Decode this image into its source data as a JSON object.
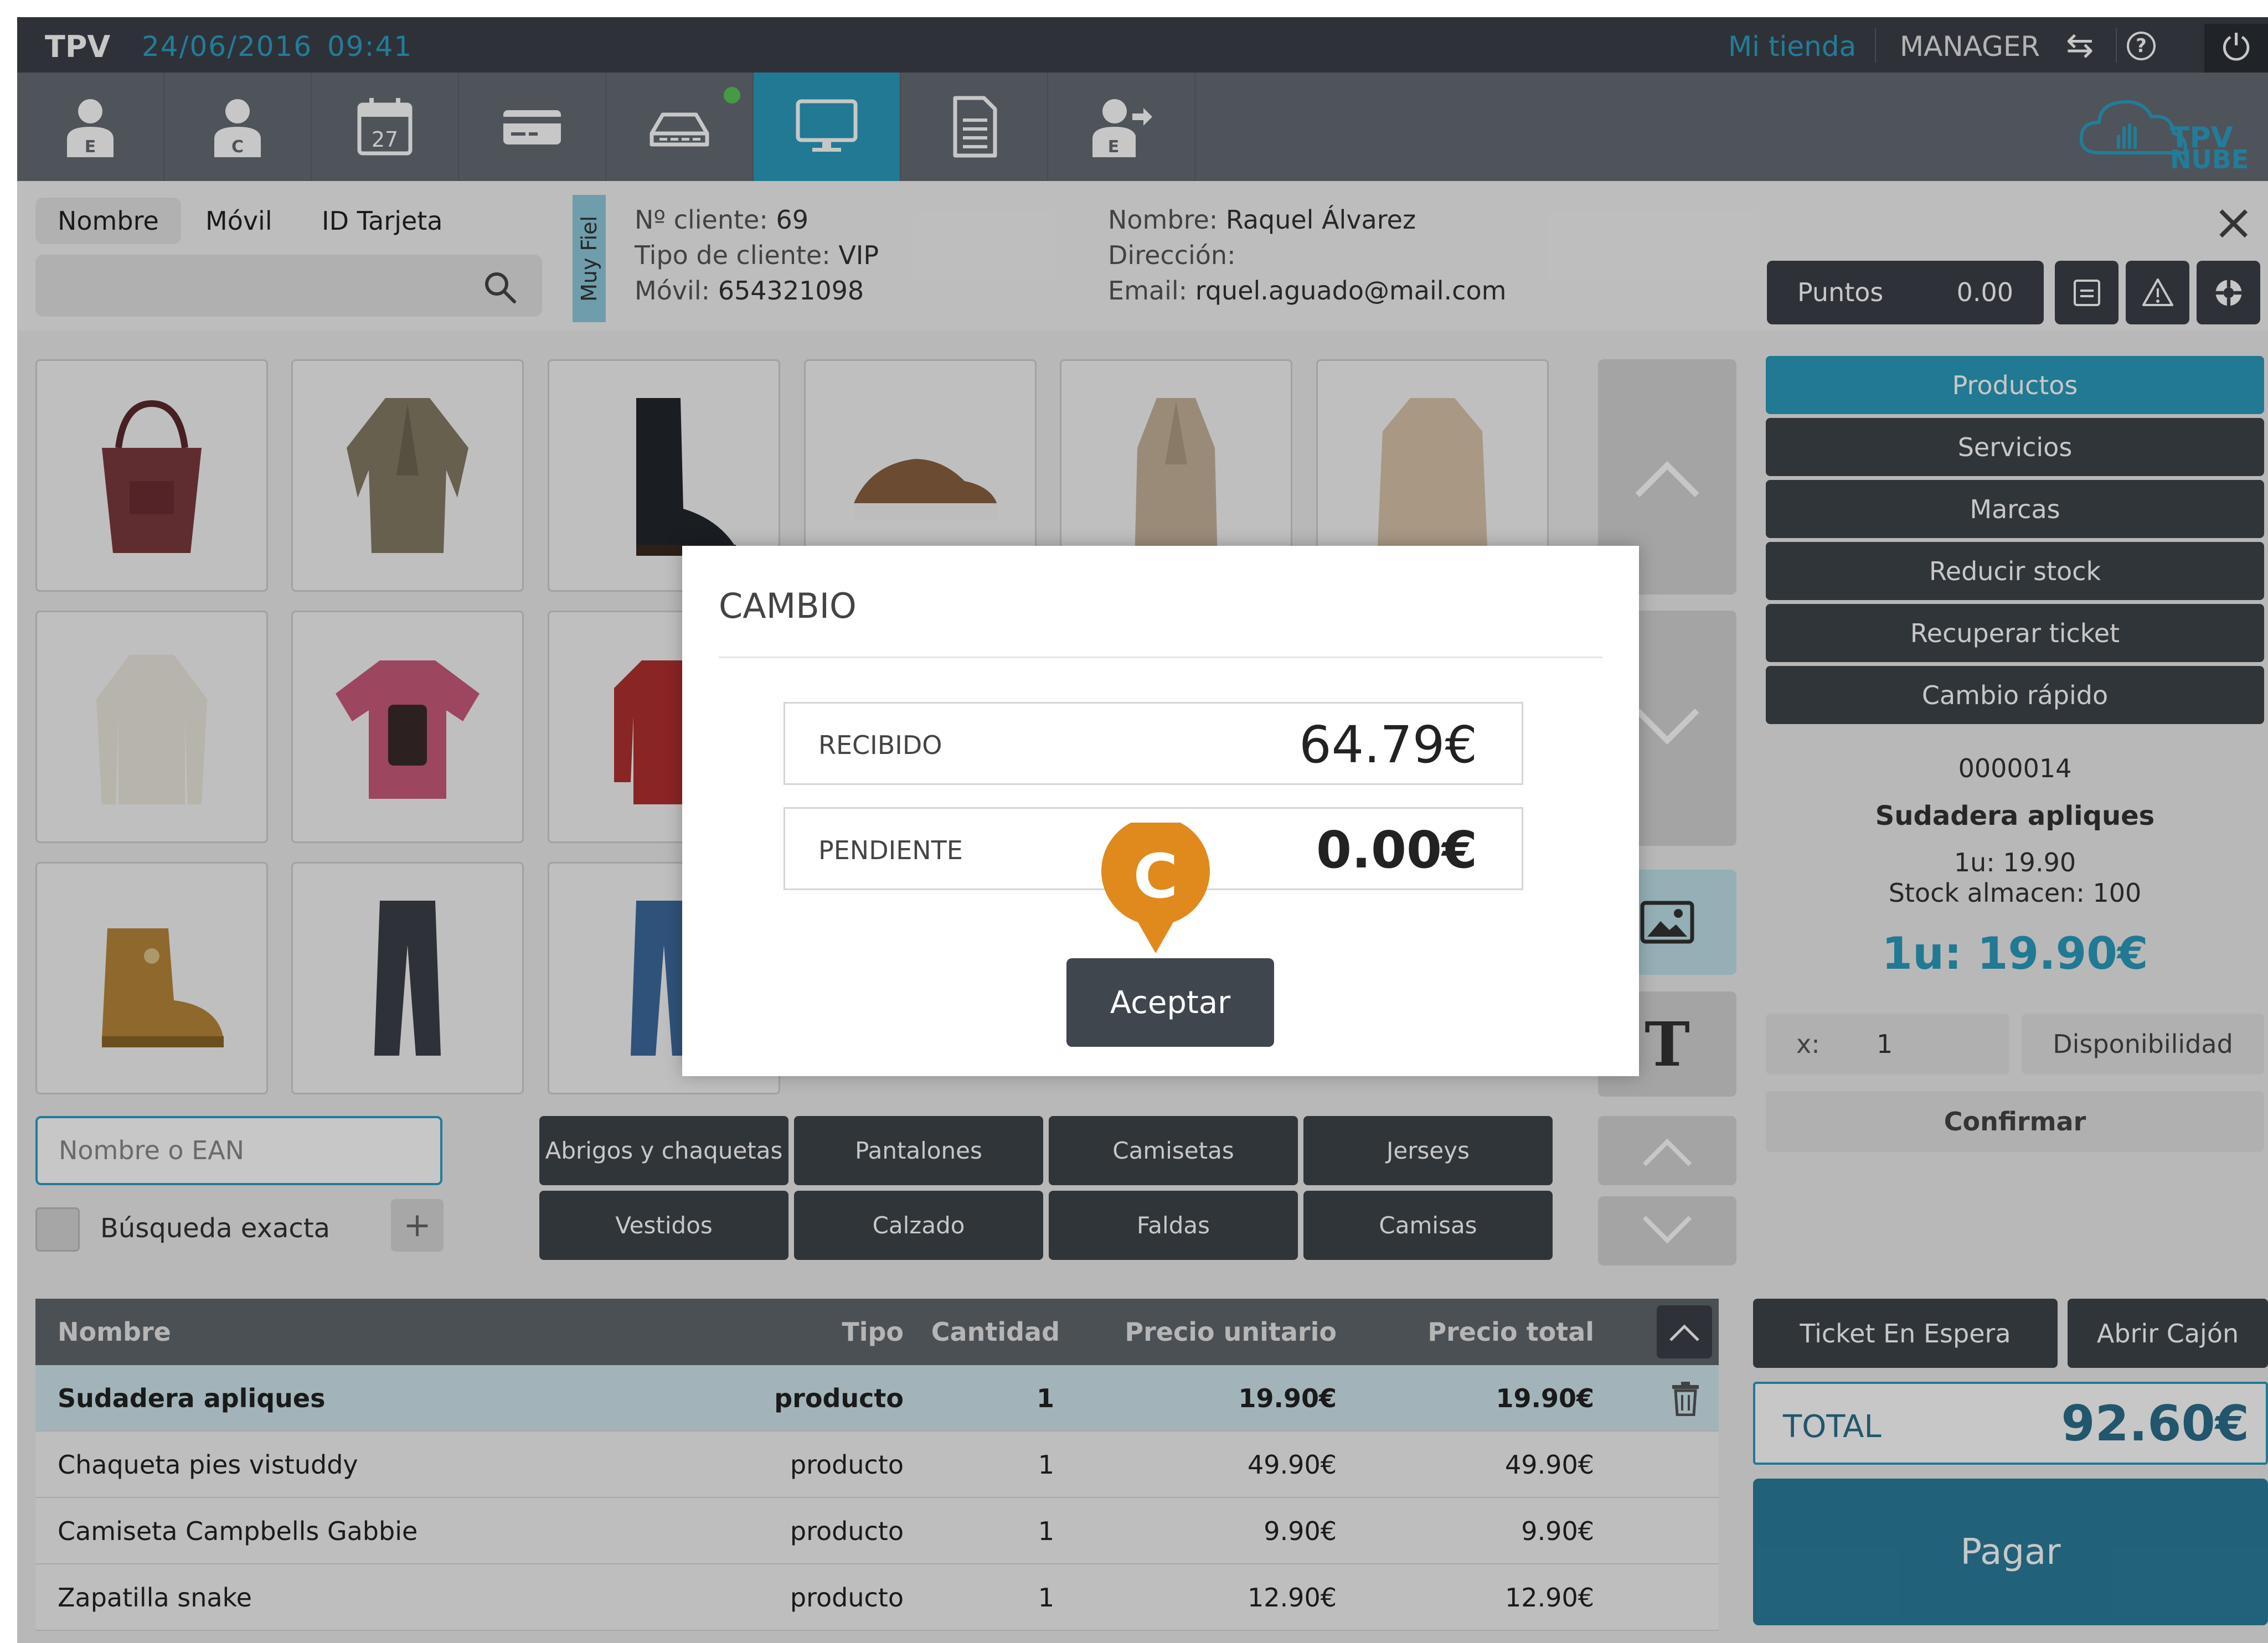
{
  "statusbar": {
    "app": "TPV",
    "date": "24/06/2016",
    "time": "09:41",
    "store": "Mi tienda",
    "user": "MANAGER",
    "help_glyph": "?",
    "power_glyph": "⏻",
    "swap_glyph": "⇆"
  },
  "toolbar": {
    "tools": [
      {
        "icon": "employee-icon",
        "letter": "E"
      },
      {
        "icon": "customer-icon",
        "letter": "C"
      },
      {
        "icon": "calendar-icon",
        "letter": "27"
      },
      {
        "icon": "card-icon"
      },
      {
        "icon": "cash-drawer-icon"
      },
      {
        "icon": "monitor-icon"
      },
      {
        "icon": "document-icon"
      },
      {
        "icon": "employee-exit-icon",
        "letter": "E"
      }
    ],
    "logo_top": "TPV",
    "logo_bottom": "NUBE"
  },
  "search": {
    "tabs": [
      "Nombre",
      "Móvil",
      "ID Tarjeta"
    ],
    "placeholder": ""
  },
  "customer": {
    "loyalty_tag": "Muy Fiel",
    "number_label": "Nº cliente:",
    "number": "69",
    "type_label": "Tipo de cliente:",
    "type": "VIP",
    "mobile_label": "Móvil:",
    "mobile": "654321098",
    "name_label": "Nombre:",
    "name": "Raquel Álvarez",
    "address_label": "Dirección:",
    "address": "",
    "email_label": "Email:",
    "email": "rquel.aguado@mail.com",
    "points_label": "Puntos",
    "points": "0.00"
  },
  "products": {
    "ean_placeholder": "Nombre o EAN",
    "exact_label": "Búsqueda exacta",
    "plus": "+",
    "categories": [
      "Abrigos y chaquetas",
      "Pantalones",
      "Camisetas",
      "Jerseys",
      "Vestidos",
      "Calzado",
      "Faldas",
      "Camisas"
    ]
  },
  "rightmenu": {
    "items": [
      "Productos",
      "Servicios",
      "Marcas",
      "Reducir stock",
      "Recuperar ticket",
      "Cambio rápido"
    ],
    "code": "0000014",
    "product_name": "Sudadera apliques",
    "unit_price": "1u: 19.90",
    "stock": "Stock almacen: 100",
    "big_price": "1u: 19.90€",
    "qty_label": "x:",
    "qty": "1",
    "availability": "Disponibilidad",
    "confirm": "Confirmar"
  },
  "table": {
    "headers": [
      "Nombre",
      "Tipo",
      "Cantidad",
      "Precio unitario",
      "Precio total"
    ],
    "rows": [
      [
        "Sudadera apliques",
        "producto",
        "1",
        "19.90€",
        "19.90€"
      ],
      [
        "Chaqueta pies vistuddy",
        "producto",
        "1",
        "49.90€",
        "49.90€"
      ],
      [
        "Camiseta Campbells Gabbie",
        "producto",
        "1",
        "9.90€",
        "9.90€"
      ],
      [
        "Zapatilla snake",
        "producto",
        "1",
        "12.90€",
        "12.90€"
      ]
    ]
  },
  "checkout": {
    "hold": "Ticket En Espera",
    "drawer": "Abrir Cajón",
    "total_label": "TOTAL",
    "total": "92.60€",
    "pay": "Pagar"
  },
  "modal": {
    "title": "CAMBIO",
    "received_label": "RECIBIDO",
    "received": "64.79€",
    "pending_label": "PENDIENTE",
    "pending": "0.00€",
    "pin_letter": "C",
    "accept": "Aceptar"
  },
  "colors": {
    "accent": "#2b9bbd",
    "dark": "#3b4148",
    "pin": "#e08a1e"
  }
}
